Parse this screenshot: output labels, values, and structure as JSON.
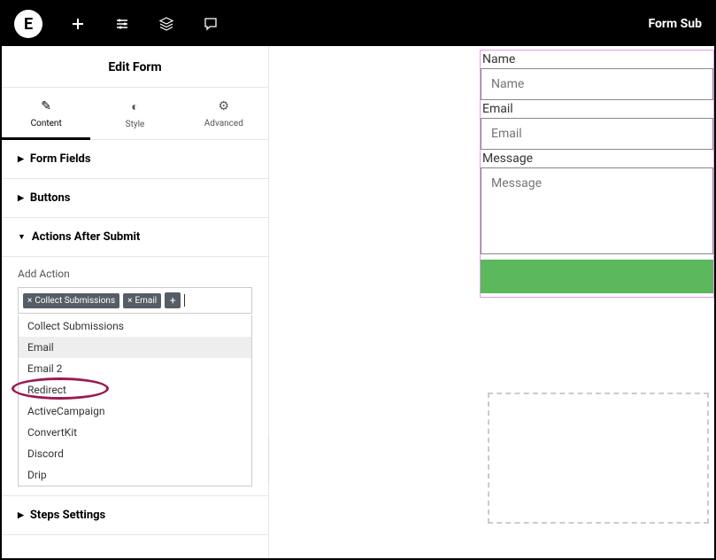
{
  "topbar": {
    "right_text": "Form Sub"
  },
  "panel": {
    "title": "Edit Form"
  },
  "tabs": {
    "content": "Content",
    "style": "Style",
    "advanced": "Advanced"
  },
  "sections": {
    "form_fields": "Form Fields",
    "buttons": "Buttons",
    "actions_after_submit": "Actions After Submit",
    "steps_settings": "Steps Settings"
  },
  "add_action": {
    "label": "Add Action",
    "tokens": [
      "Collect Submissions",
      "Email"
    ],
    "options": [
      "Collect Submissions",
      "Email",
      "Email 2",
      "Redirect",
      "ActiveCampaign",
      "ConvertKit",
      "Discord",
      "Drip"
    ]
  },
  "form_preview": {
    "name_label": "Name",
    "name_placeholder": "Name",
    "email_label": "Email",
    "email_placeholder": "Email",
    "message_label": "Message",
    "message_placeholder": "Message"
  }
}
